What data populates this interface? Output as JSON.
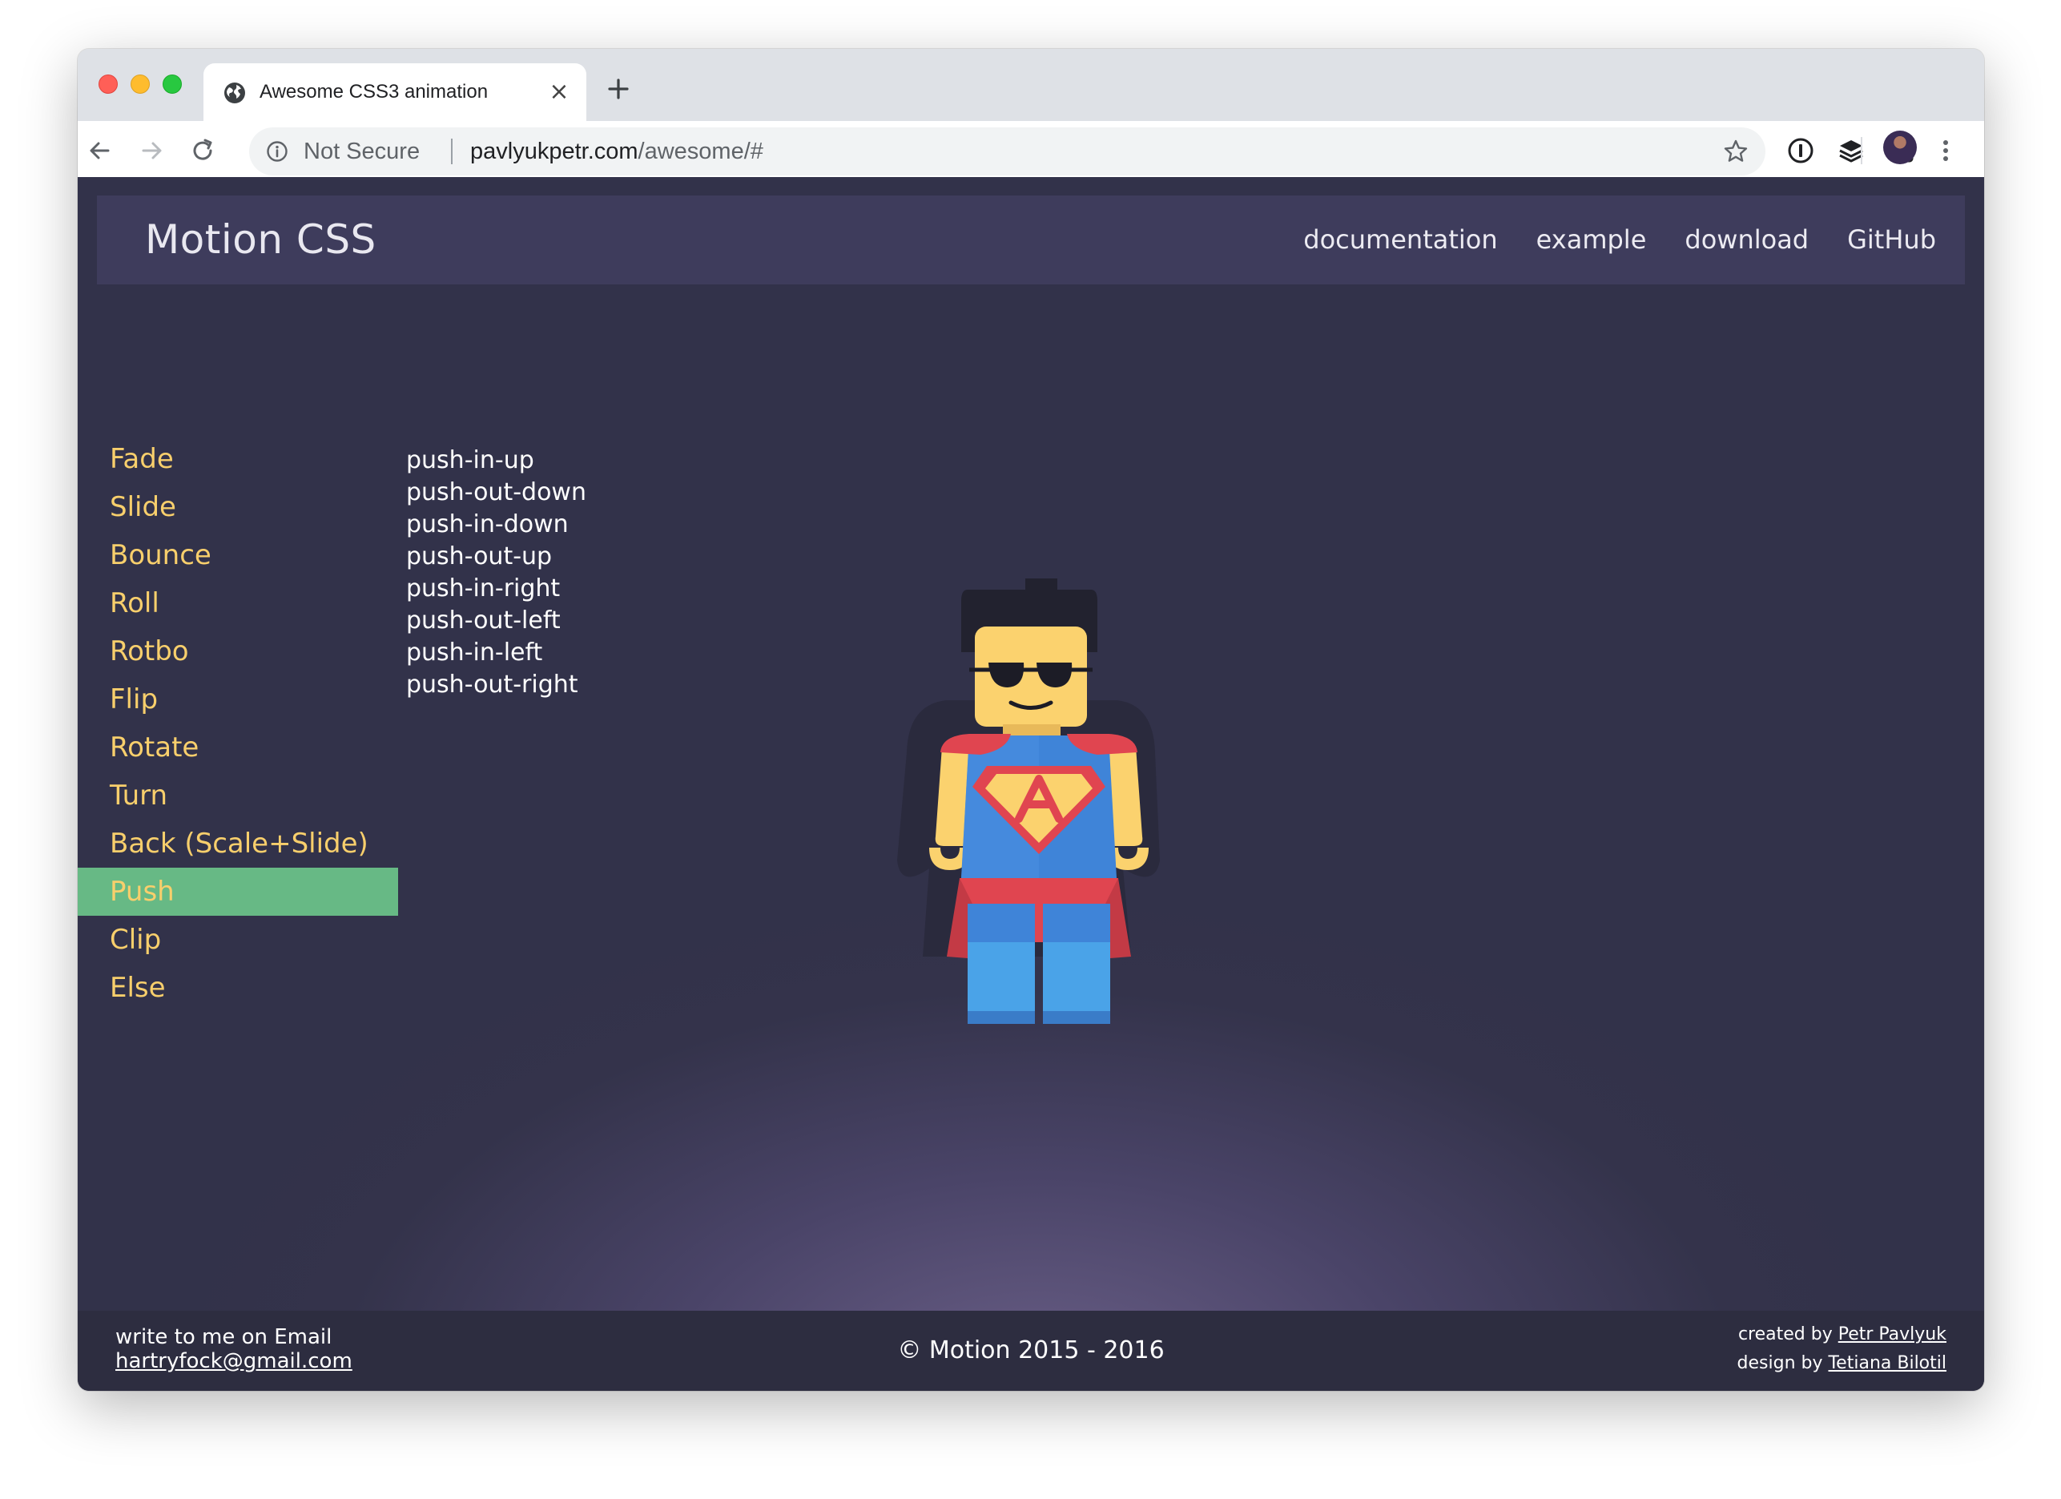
{
  "browser": {
    "tab_title": "Awesome CSS3 animation",
    "tab_close_glyph": "×",
    "security_label": "Not Secure",
    "url_host": "pavlyukpetr.com",
    "url_path": "/awesome/#",
    "icons": [
      "globe-icon",
      "close-icon",
      "plus-icon",
      "back-icon",
      "forward-icon",
      "reload-icon",
      "info-icon",
      "star-icon",
      "password-manager-icon",
      "layers-icon",
      "notion-icon",
      "profile-avatar",
      "kebab-menu-icon"
    ]
  },
  "site": {
    "brand": "Motion CSS",
    "nav": [
      {
        "label": "documentation"
      },
      {
        "label": "example"
      },
      {
        "label": "download"
      },
      {
        "label": "GitHub"
      }
    ],
    "menu": [
      {
        "label": "Fade",
        "active": false
      },
      {
        "label": "Slide",
        "active": false
      },
      {
        "label": "Bounce",
        "active": false
      },
      {
        "label": "Roll",
        "active": false
      },
      {
        "label": "Rotbo",
        "active": false
      },
      {
        "label": "Flip",
        "active": false
      },
      {
        "label": "Rotate",
        "active": false
      },
      {
        "label": "Turn",
        "active": false
      },
      {
        "label": "Back (Scale+Slide)",
        "active": false
      },
      {
        "label": "Push",
        "active": true
      },
      {
        "label": "Clip",
        "active": false
      },
      {
        "label": "Else",
        "active": false
      }
    ],
    "effects": [
      "push-in-up",
      "push-out-down",
      "push-in-down",
      "push-out-up",
      "push-in-right",
      "push-out-left",
      "push-in-left",
      "push-out-right"
    ],
    "figure_badge": "A",
    "footer": {
      "contact_label": "write to me on Email",
      "email": "hartryfock@gmail.com",
      "copyright": "© Motion 2015 - 2016",
      "created_prefix": "created by ",
      "created_name": "Petr Pavlyuk",
      "design_prefix": "design by ",
      "design_name": "Tetiana Bilotil"
    }
  },
  "colors": {
    "menu_text": "#f8cf6c",
    "menu_active_bg": "#67b985",
    "navbar_bg": "#3e3c5c",
    "page_bg": "#34334b",
    "footer_bg": "#2d2d40"
  }
}
